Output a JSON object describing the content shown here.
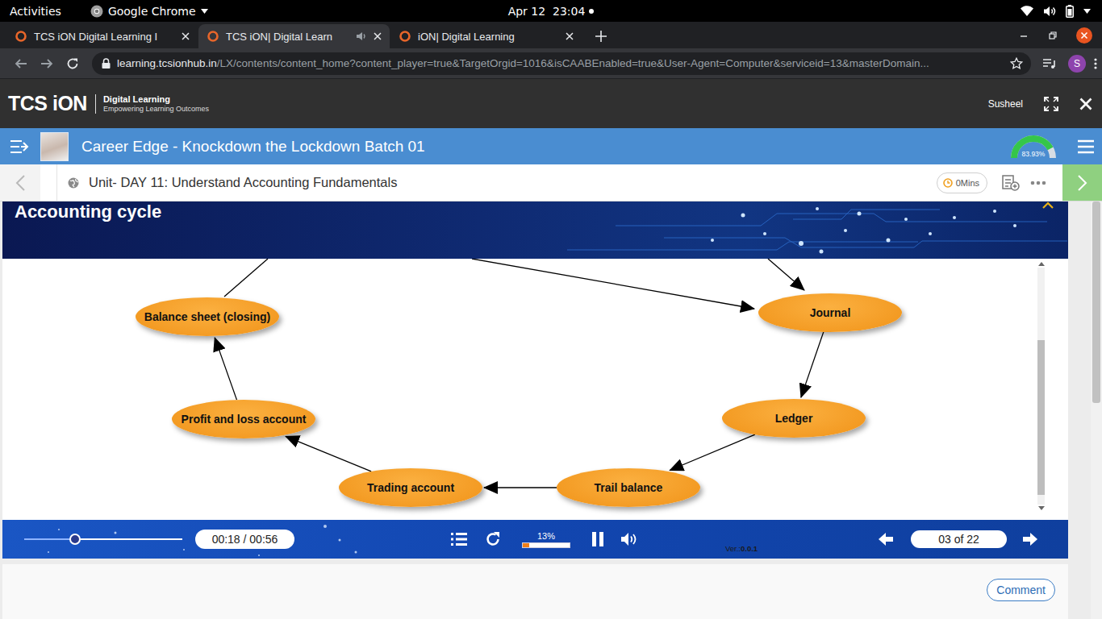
{
  "system_bar": {
    "activities": "Activities",
    "app": "Google Chrome",
    "clock": "Apr 12  23:04"
  },
  "browser": {
    "tabs": [
      {
        "label": "TCS iON Digital Learning I",
        "selected": false,
        "audio": false
      },
      {
        "label": "TCS iON| Digital Learn",
        "selected": true,
        "audio": true
      },
      {
        "label": "iON| Digital Learning",
        "selected": false,
        "audio": false
      }
    ],
    "url": {
      "host": "learning.tcsionhub.in",
      "path": "/LX/contents/content_home?content_player=true&TargetOrgid=1016&isCAABEnabled=true&User-Agent=Computer&serviceid=13&masterDomain..."
    },
    "profile": "S"
  },
  "site_header": {
    "logo": "TCS iON",
    "logo_line1": "Digital Learning",
    "logo_line2": "Empowering Learning Outcomes",
    "user": "Susheel"
  },
  "course_bar": {
    "title": "Career Edge - Knockdown the Lockdown Batch 01",
    "progress_label": "83.93%",
    "progress": 0.8393
  },
  "unit_bar": {
    "title": "Unit- DAY 11: Understand Accounting Fundamentals",
    "time": "0Mins"
  },
  "slide": {
    "title": "Accounting cycle",
    "nodes": [
      {
        "label": "Journal"
      },
      {
        "label": "Ledger"
      },
      {
        "label": "Trail balance"
      },
      {
        "label": "Trading account"
      },
      {
        "label": "Profit and loss account"
      },
      {
        "label": "Balance sheet (closing)"
      }
    ],
    "edges": [
      {
        "from": 0,
        "to": 1
      },
      {
        "from": 1,
        "to": 2
      },
      {
        "from": 2,
        "to": 3
      },
      {
        "from": 3,
        "to": 4
      },
      {
        "from": 4,
        "to": 5
      }
    ]
  },
  "player": {
    "time": "00:18 / 00:56",
    "seek": 0.32,
    "percent": "13%",
    "progress": 0.13,
    "playing": true,
    "version_label": "Ver.:",
    "version": "0.0.1",
    "page": "03 of 22"
  },
  "footer": {
    "comment": "Comment"
  }
}
